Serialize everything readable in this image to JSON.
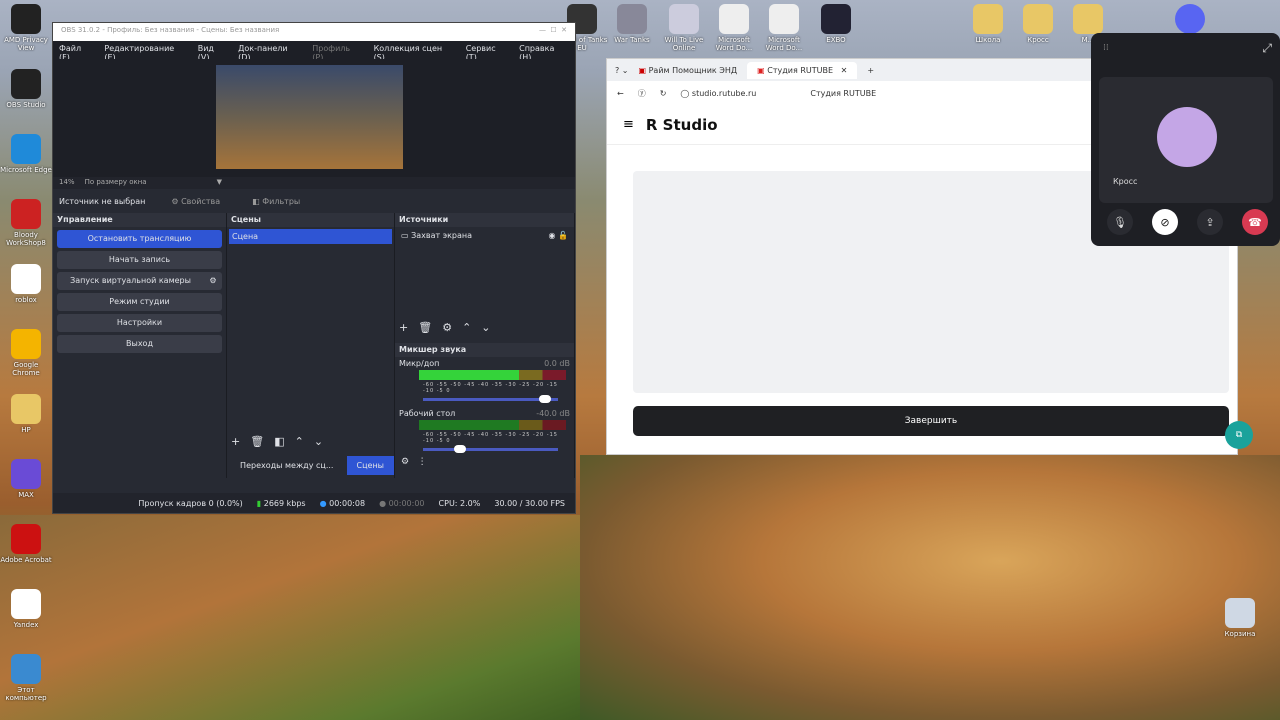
{
  "desktop": {
    "left_icons": [
      "AMD Privacy View",
      "OBS Studio",
      "Microsoft Edge",
      "Bloody WorkShop8",
      "roblox",
      "Google Chrome",
      "HP",
      "MAX",
      "Adobe Acrobat",
      "Yandex",
      "Этот компьютер"
    ],
    "top_icons": [
      "World of Tanks EU",
      "War Tanks",
      "Will To Live Online",
      "Microsoft Word Do...",
      "Microsoft Word Do...",
      "EXBO"
    ],
    "right_icons": [
      "Школа",
      "Кросс",
      "M..."
    ],
    "recycle": "Корзина"
  },
  "obs": {
    "title": "OBS 31.0.2 - Профиль: Без названия - Сцены: Без названия",
    "menu": [
      "Файл (F)",
      "Редактирование (E)",
      "Вид (V)",
      "Док-панели (D)",
      "Профиль (P)",
      "Коллекция сцен (S)",
      "Сервис (T)",
      "Справка (H)"
    ],
    "zoom": "14%",
    "fit": "По размеру окна",
    "no_source": "Источник не выбран",
    "properties": "Свойства",
    "filters": "Фильтры",
    "controls_title": "Управление",
    "controls": [
      "Остановить трансляцию",
      "Начать запись",
      "Запуск виртуальной камеры",
      "Режим студии",
      "Настройки",
      "Выход"
    ],
    "scenes_title": "Сцены",
    "scenes": [
      "Сцена"
    ],
    "sources_title": "Источники",
    "sources": [
      "Захват экрана"
    ],
    "mixer_title": "Микшер звука",
    "channels": [
      {
        "name": "Микр/доп",
        "db": "0.0 dB",
        "level": 0.95
      },
      {
        "name": "Рабочий стол",
        "db": "-40.0 dB",
        "level": 0.32
      }
    ],
    "scale": "-60 -55 -50 -45 -40 -35 -30 -25 -20 -15 -10 -5 0",
    "transitions_tab": "Переходы между сц...",
    "scenes_tab": "Сцены",
    "status": {
      "dropped": "Пропуск кадров 0 (0.0%)",
      "bitrate": "2669 kbps",
      "stream_time": "00:00:08",
      "rec_time": "00:00:00",
      "cpu": "CPU: 2.0%",
      "fps": "30.00 / 30.00 FPS"
    }
  },
  "browser": {
    "tabs": [
      "Райм Помощник ЭНД",
      "Студия RUTUBE"
    ],
    "url": "studio.rutube.ru",
    "page_title": "Студия RUTUBE",
    "logo": "R Studio",
    "finish": "Завершить"
  },
  "discord": {
    "user": "Кросс"
  }
}
